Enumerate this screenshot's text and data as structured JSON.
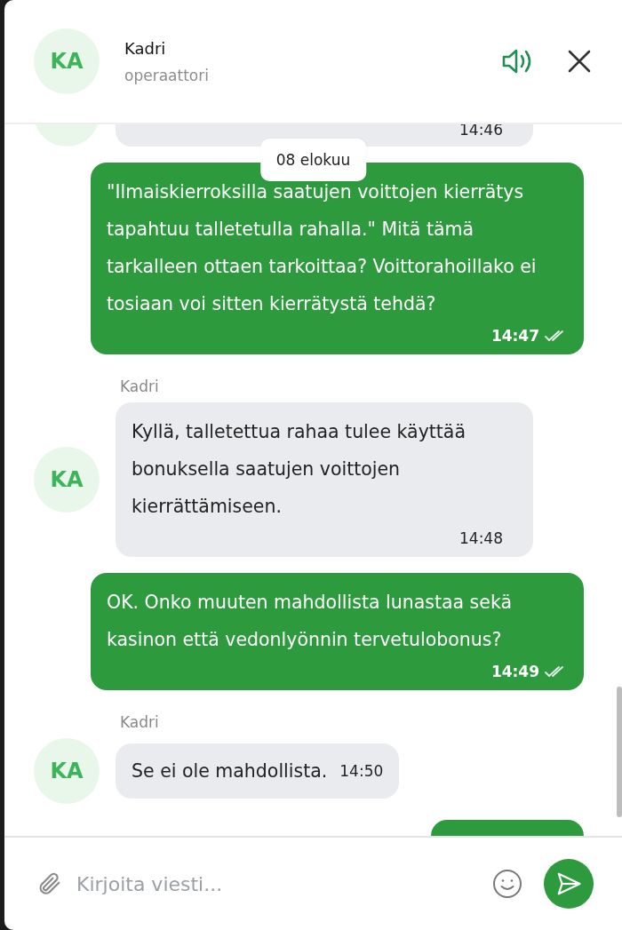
{
  "header": {
    "avatar": "KA",
    "name": "Kadri",
    "role": "operaattori",
    "sound_on": true
  },
  "date_chip": "08 elokuu",
  "messages": [
    {
      "kind": "incoming",
      "time": "14:46",
      "partial": true
    },
    {
      "kind": "outgoing",
      "text": "\"Ilmaiskierroksilla saatujen voittojen kierrätys tapahtuu talletetulla rahalla.\" Mitä tämä tarkalleen ottaen tarkoittaa? Voittorahoillako ei tosiaan voi sitten kierrätystä tehdä?",
      "time": "14:47",
      "read": true
    },
    {
      "kind": "incoming",
      "sender": "Kadri",
      "avatar": "KA",
      "text": "Kyllä, talletettua rahaa tulee käyttää bonuksella saatujen voittojen kierrättämiseen.",
      "time": "14:48"
    },
    {
      "kind": "outgoing",
      "text": "OK. Onko muuten mahdollista lunastaa sekä kasinon että vedonlyönnin tervetulobonus?",
      "time": "14:49",
      "read": true
    },
    {
      "kind": "incoming",
      "sender": "Kadri",
      "avatar": "KA",
      "text": "Se ei ole mahdollista.",
      "time": "14:50",
      "inline_time": true
    },
    {
      "kind": "outgoing",
      "partial": true
    }
  ],
  "composer": {
    "placeholder": "Kirjoita viesti..."
  }
}
